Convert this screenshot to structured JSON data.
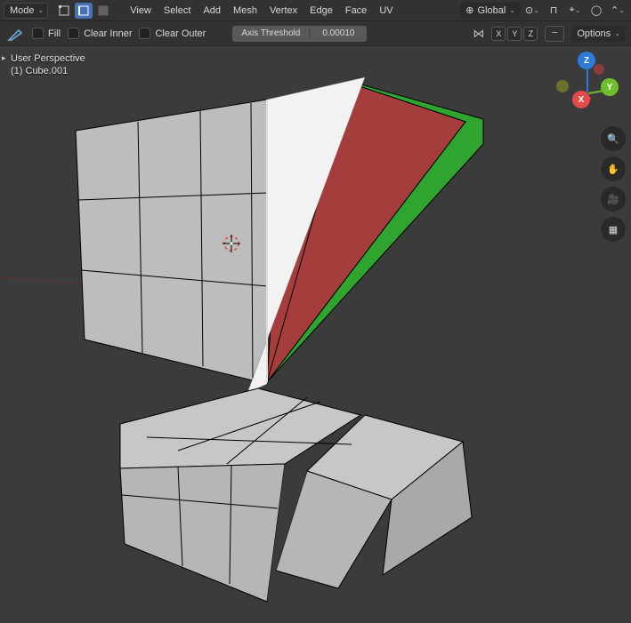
{
  "header": {
    "mode_label": "Mode",
    "menu": [
      "View",
      "Select",
      "Add",
      "Mesh",
      "Vertex",
      "Edge",
      "Face",
      "UV"
    ],
    "orientation_label": "Global"
  },
  "subbar": {
    "fill_label": "Fill",
    "clear_inner_label": "Clear Inner",
    "clear_outer_label": "Clear Outer",
    "axis_threshold_label": "Axis Threshold",
    "axis_threshold_value": "0.00010",
    "xyz": [
      "X",
      "Y",
      "Z"
    ],
    "options_label": "Options"
  },
  "overlay": {
    "line1": "User Perspective",
    "line2": "(1) Cube.001"
  },
  "gizmo": {
    "x": "X",
    "y": "Y",
    "z": "Z"
  }
}
